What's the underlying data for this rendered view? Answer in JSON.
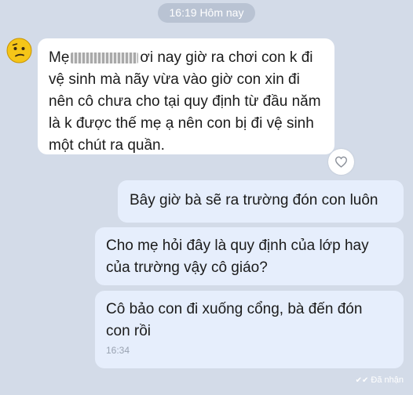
{
  "header": {
    "timestamp": "16:19 Hôm nay"
  },
  "incoming": {
    "line1_start": "Mẹ",
    "line1_end": "ơi nay giờ ra chơi con k đi",
    "rest": "vệ sinh mà nãy vừa vào giờ con xin đi\nnên cô chưa cho tại quy định từ đầu năm\nlà k được thế mẹ ạ nên con bị đi vệ sinh\nmột chút ra quần.",
    "avatar_icon": "confused-face-emoji",
    "reaction_icon": "heart-outline-icon"
  },
  "outgoing": [
    {
      "text": "Bây giờ bà sẽ ra trường đón con luôn"
    },
    {
      "text": "Cho mẹ hỏi đây là quy định của lớp hay\ncủa trường vậy cô giáo?"
    },
    {
      "text": "Cô bảo con đi xuống cổng, bà đến đón\ncon rồi",
      "time": "16:34"
    }
  ],
  "status": {
    "receipt": "Đã nhận"
  },
  "colors": {
    "background": "#d3dbe8",
    "incoming_bubble": "#ffffff",
    "outgoing_bubble": "#e6eefc",
    "pill": "#b9c3d3"
  }
}
